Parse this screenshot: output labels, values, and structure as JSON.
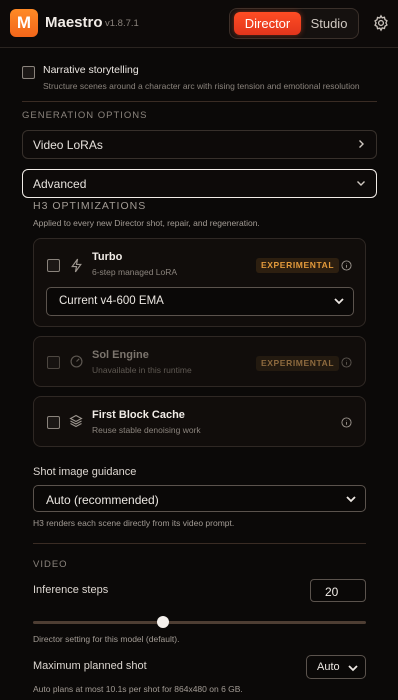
{
  "header": {
    "logo_letter": "M",
    "app_name": "Maestro",
    "version": "v1.8.7.1",
    "modes": [
      "Director",
      "Studio"
    ],
    "active_mode": "Director",
    "settings_icon": "gear-icon"
  },
  "narrative": {
    "title": "Narrative storytelling",
    "description": "Structure scenes around a character arc with rising tension and emotional resolution",
    "checked": false
  },
  "generation": {
    "heading": "GENERATION OPTIONS",
    "video_loras_label": "Video LoRAs",
    "advanced_label": "Advanced"
  },
  "h3": {
    "heading": "H3 OPTIMIZATIONS",
    "subtitle": "Applied to every new Director shot, repair, and regeneration.",
    "turbo": {
      "title": "Turbo",
      "description": "6-step managed LoRA",
      "badge": "EXPERIMENTAL",
      "select_value": "Current v4-600 EMA",
      "checked": false,
      "icon": "bolt-icon"
    },
    "sol": {
      "title": "Sol Engine",
      "description": "Unavailable in this runtime",
      "badge": "EXPERIMENTAL",
      "checked": false,
      "disabled": true,
      "icon": "gauge-icon"
    },
    "fbc": {
      "title": "First Block Cache",
      "description": "Reuse stable denoising work",
      "checked": false,
      "icon": "layers-icon"
    }
  },
  "guidance": {
    "label": "Shot image guidance",
    "value": "Auto (recommended)",
    "help": "H3 renders each scene directly from its video prompt."
  },
  "video": {
    "heading": "VIDEO",
    "steps_label": "Inference steps",
    "steps_value": "20",
    "steps_slider_fraction": 0.39,
    "steps_help": "Director setting for this model (default).",
    "max_shot_label": "Maximum planned shot",
    "max_shot_value": "Auto",
    "max_shot_help": "Auto plans at most 10.1s per shot for 864x480 on 6 GB."
  },
  "colors": {
    "accent": "#ff4d24",
    "logo": "#f2661a",
    "badge_text": "#e39a3b",
    "background": "#0b0908"
  }
}
